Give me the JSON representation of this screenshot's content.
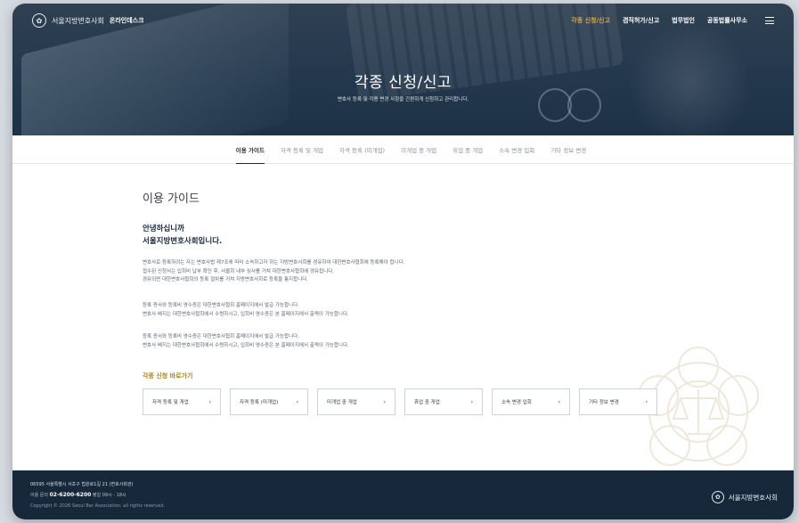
{
  "header": {
    "logo_name": "서울지방변호사회",
    "logo_sub": "온라인데스크",
    "nav": [
      {
        "label": "각종 신청/신고",
        "active": true
      },
      {
        "label": "겸직허가/신고",
        "active": false
      },
      {
        "label": "법무법인",
        "active": false
      },
      {
        "label": "공동법률사무소",
        "active": false
      }
    ],
    "hero_title": "각종 신청/신고",
    "hero_subtitle": "변호사 등록 및 각종 변경 사항을 간편하게 신청하고 관리합니다."
  },
  "tabs": [
    {
      "label": "이용 가이드",
      "active": true
    },
    {
      "label": "자격 등록 및 개업",
      "active": false
    },
    {
      "label": "자격 등록 (미개업)",
      "active": false
    },
    {
      "label": "미개업 중 개업",
      "active": false
    },
    {
      "label": "휴업 중 개업",
      "active": false
    },
    {
      "label": "소속 변경 입회",
      "active": false
    },
    {
      "label": "기타 정보 변경",
      "active": false
    }
  ],
  "content": {
    "title": "이용 가이드",
    "greeting_line1": "안녕하십니까",
    "greeting_line2": "서울지방변호사회입니다.",
    "paragraph1": [
      "변호사로 등록하려는 자는 변호사법 제7조에 따라 소속하고자 하는 지방변호사회를 경유하여 대한변호사협회에 등록해야 합니다.",
      "접수된 신청서는 입회비 납부 확인 후, 서울회 내부 심사를 거쳐 대한변호사협회에 경유됩니다.",
      "경유되면 대한변호사협회의 등록 절차를 거쳐 지방변호사회로 등록을 통지합니다."
    ],
    "paragraph2": [
      "등록 증서와 등록비 영수증은 대한변호사협회 홈페이지에서 발급 가능합니다.",
      "변호사 배지는 대한변호사협회에서 수령하시고, 입회비 영수증은 본 홈페이지에서 출력이 가능합니다."
    ],
    "paragraph3": [
      "등록 증서와 등록비 영수증은 대한변호사협회 홈페이지에서 발급 가능합니다.",
      "변호사 배지는 대한변호사협회에서 수령하시고, 입회비 영수증은 본 홈페이지에서 출력이 가능합니다."
    ],
    "shortcut_title": "각종 신청 바로가기",
    "shortcuts": [
      {
        "label": "자격 등록 및 개업"
      },
      {
        "label": "자격 등록 (미개업)"
      },
      {
        "label": "미개업 중 개업"
      },
      {
        "label": "휴업 중 개업"
      },
      {
        "label": "소속 변경 입회"
      },
      {
        "label": "기타 정보 변경"
      }
    ],
    "chevron": "›"
  },
  "footer": {
    "address": "06595 서울특별시 서초구 법원로1길 21 (변호사회관)",
    "phone_label": "이용 문의",
    "phone": "02-6200-6200",
    "hours": "평일 09시 - 18시",
    "copyright": "Copyright © 2026 Seoul Bar Association. all rights reserved.",
    "logo_name": "서울지방변호사회"
  },
  "colors": {
    "hero": "#24384d",
    "accent_gold": "#d5a84b",
    "footer": "#17283b"
  },
  "icons": {
    "logo": "seal-icon",
    "menu": "hamburger-menu-icon"
  }
}
